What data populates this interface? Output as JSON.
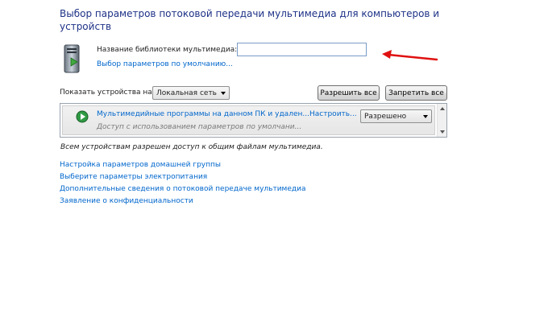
{
  "title": "Выбор параметров потоковой передачи мультимедиа для компьютеров и устройств",
  "library": {
    "label": "Название библиотеки мультимедиа:",
    "value": "",
    "defaults_link": "Выбор параметров по умолчанию..."
  },
  "devices": {
    "show_label": "Показать устройства на:",
    "network_selected": "Локальная сеть",
    "allow_all_label": "Разрешить все",
    "deny_all_label": "Запретить все",
    "rows": [
      {
        "title": "Мультимедийные программы на данном ПК и удален...",
        "subtitle": "Доступ с использованием параметров по умолчани...",
        "settings_link": "Настроить...",
        "status": "Разрешено"
      }
    ],
    "note": "Всем устройствам разрешен доступ к общим файлам мультимедиа."
  },
  "links": [
    "Настройка параметров домашней группы",
    "Выберите параметры электропитания",
    "Дополнительные сведения о потоковой передаче мультимедиа",
    "Заявление о конфиденциальности"
  ],
  "colors": {
    "link": "#0066cc",
    "title": "#1e3287",
    "annotation_arrow": "#e01010"
  },
  "icons": {
    "library": "media-server-icon",
    "row": "media-player-icon"
  }
}
